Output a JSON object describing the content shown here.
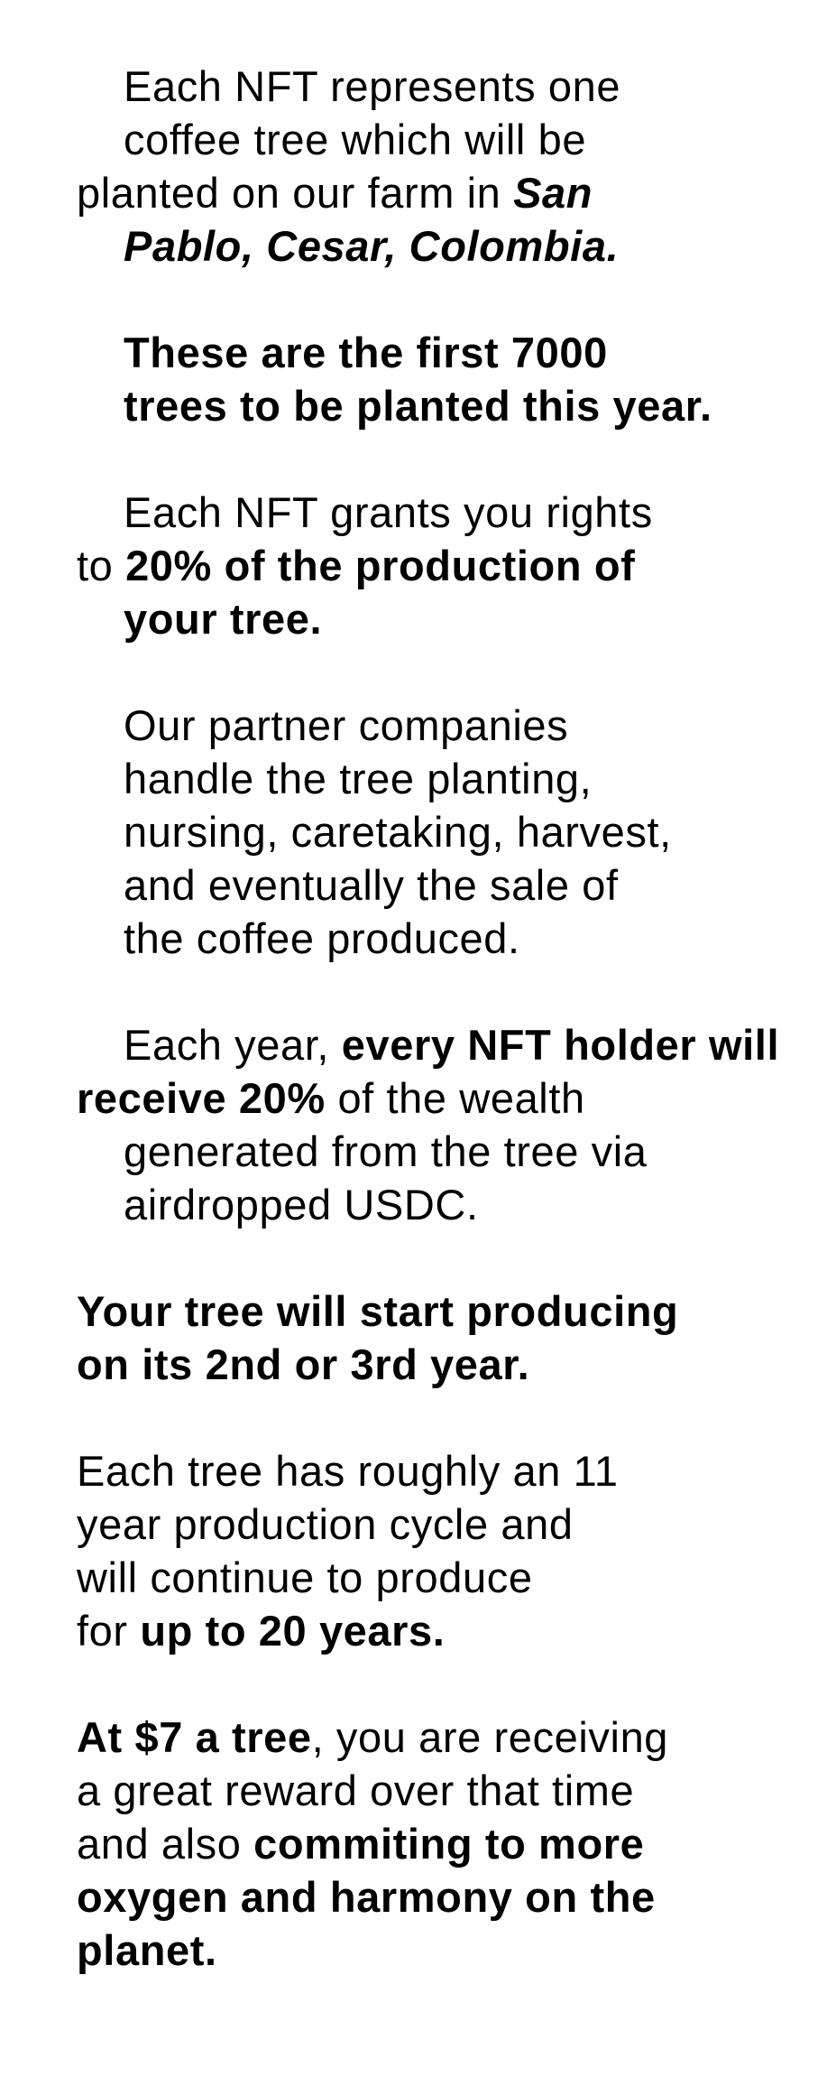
{
  "paragraphs": {
    "p1": {
      "t1": "Each NFT represents one",
      "t2": "coffee tree which will be",
      "t3": "planted on our farm in ",
      "t4": "San",
      "t5": "Pablo, Cesar, Colombia."
    },
    "p2": {
      "t1": "These are the first 7000",
      "t2": "trees to be planted this year."
    },
    "p3": {
      "t1": "Each NFT grants you rights",
      "t2": "to ",
      "t3": "20% of the production of",
      "t4": "your tree."
    },
    "p4": {
      "t1": "Our partner companies",
      "t2": "handle the tree planting,",
      "t3": "nursing, caretaking, harvest,",
      "t4": "and eventually the sale of",
      "t5": "the coffee produced."
    },
    "p5": {
      "t1": "Each year, ",
      "t2": "every ",
      "t3": "NFT holder",
      "t4": "will receive 20%",
      "t5": " of the wealth",
      "t6": "generated from the tree via",
      "t7": "airdropped USDC."
    },
    "p6": {
      "t1": "Your tree will start producing",
      "t2": "on its 2nd or 3rd year."
    },
    "p7": {
      "t1": "Each tree has roughly an 11",
      "t2": "year production cycle and",
      "t3": "will continue to produce",
      "t4": "for ",
      "t5": "up to 20 years."
    },
    "p8": {
      "t1": "At $7 a tree",
      "t2": ", you are receiving",
      "t3": "a great reward over that time",
      "t4": "and also ",
      "t5": "commiting to more",
      "t6": "oxygen and harmony on the",
      "t7": "planet."
    }
  }
}
